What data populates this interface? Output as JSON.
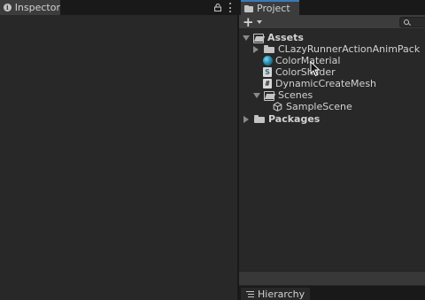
{
  "inspector": {
    "tab_label": "Inspector",
    "tab_icon": "info-icon"
  },
  "project": {
    "tab_label": "Project",
    "tab_icon": "folder-icon",
    "toolbar": {
      "add_label": "+"
    },
    "tree": {
      "assets": {
        "label": "Assets",
        "expanded": true,
        "children": [
          {
            "label": "CLazyRunnerActionAnimPack",
            "icon": "folder-icon",
            "expanded": false
          },
          {
            "label": "ColorMaterial",
            "icon": "material-icon"
          },
          {
            "label": "ColorShader",
            "icon": "shader-icon",
            "glyph": "S"
          },
          {
            "label": "DynamicCreateMesh",
            "icon": "script-icon",
            "glyph": "#"
          },
          {
            "label": "Scenes",
            "icon": "folder-open-icon",
            "expanded": true
          },
          {
            "label": "SampleScene",
            "icon": "unity-scene-icon"
          }
        ]
      },
      "packages": {
        "label": "Packages",
        "expanded": false
      }
    }
  },
  "hierarchy": {
    "tab_label": "Hierarchy",
    "tab_icon": "list-icon"
  },
  "colors": {
    "panel_bg": "#282828",
    "tab_bg": "#3c3c3c",
    "frame_bg": "#191919",
    "accent": "#3a79bb",
    "text": "#d2d2d2"
  }
}
